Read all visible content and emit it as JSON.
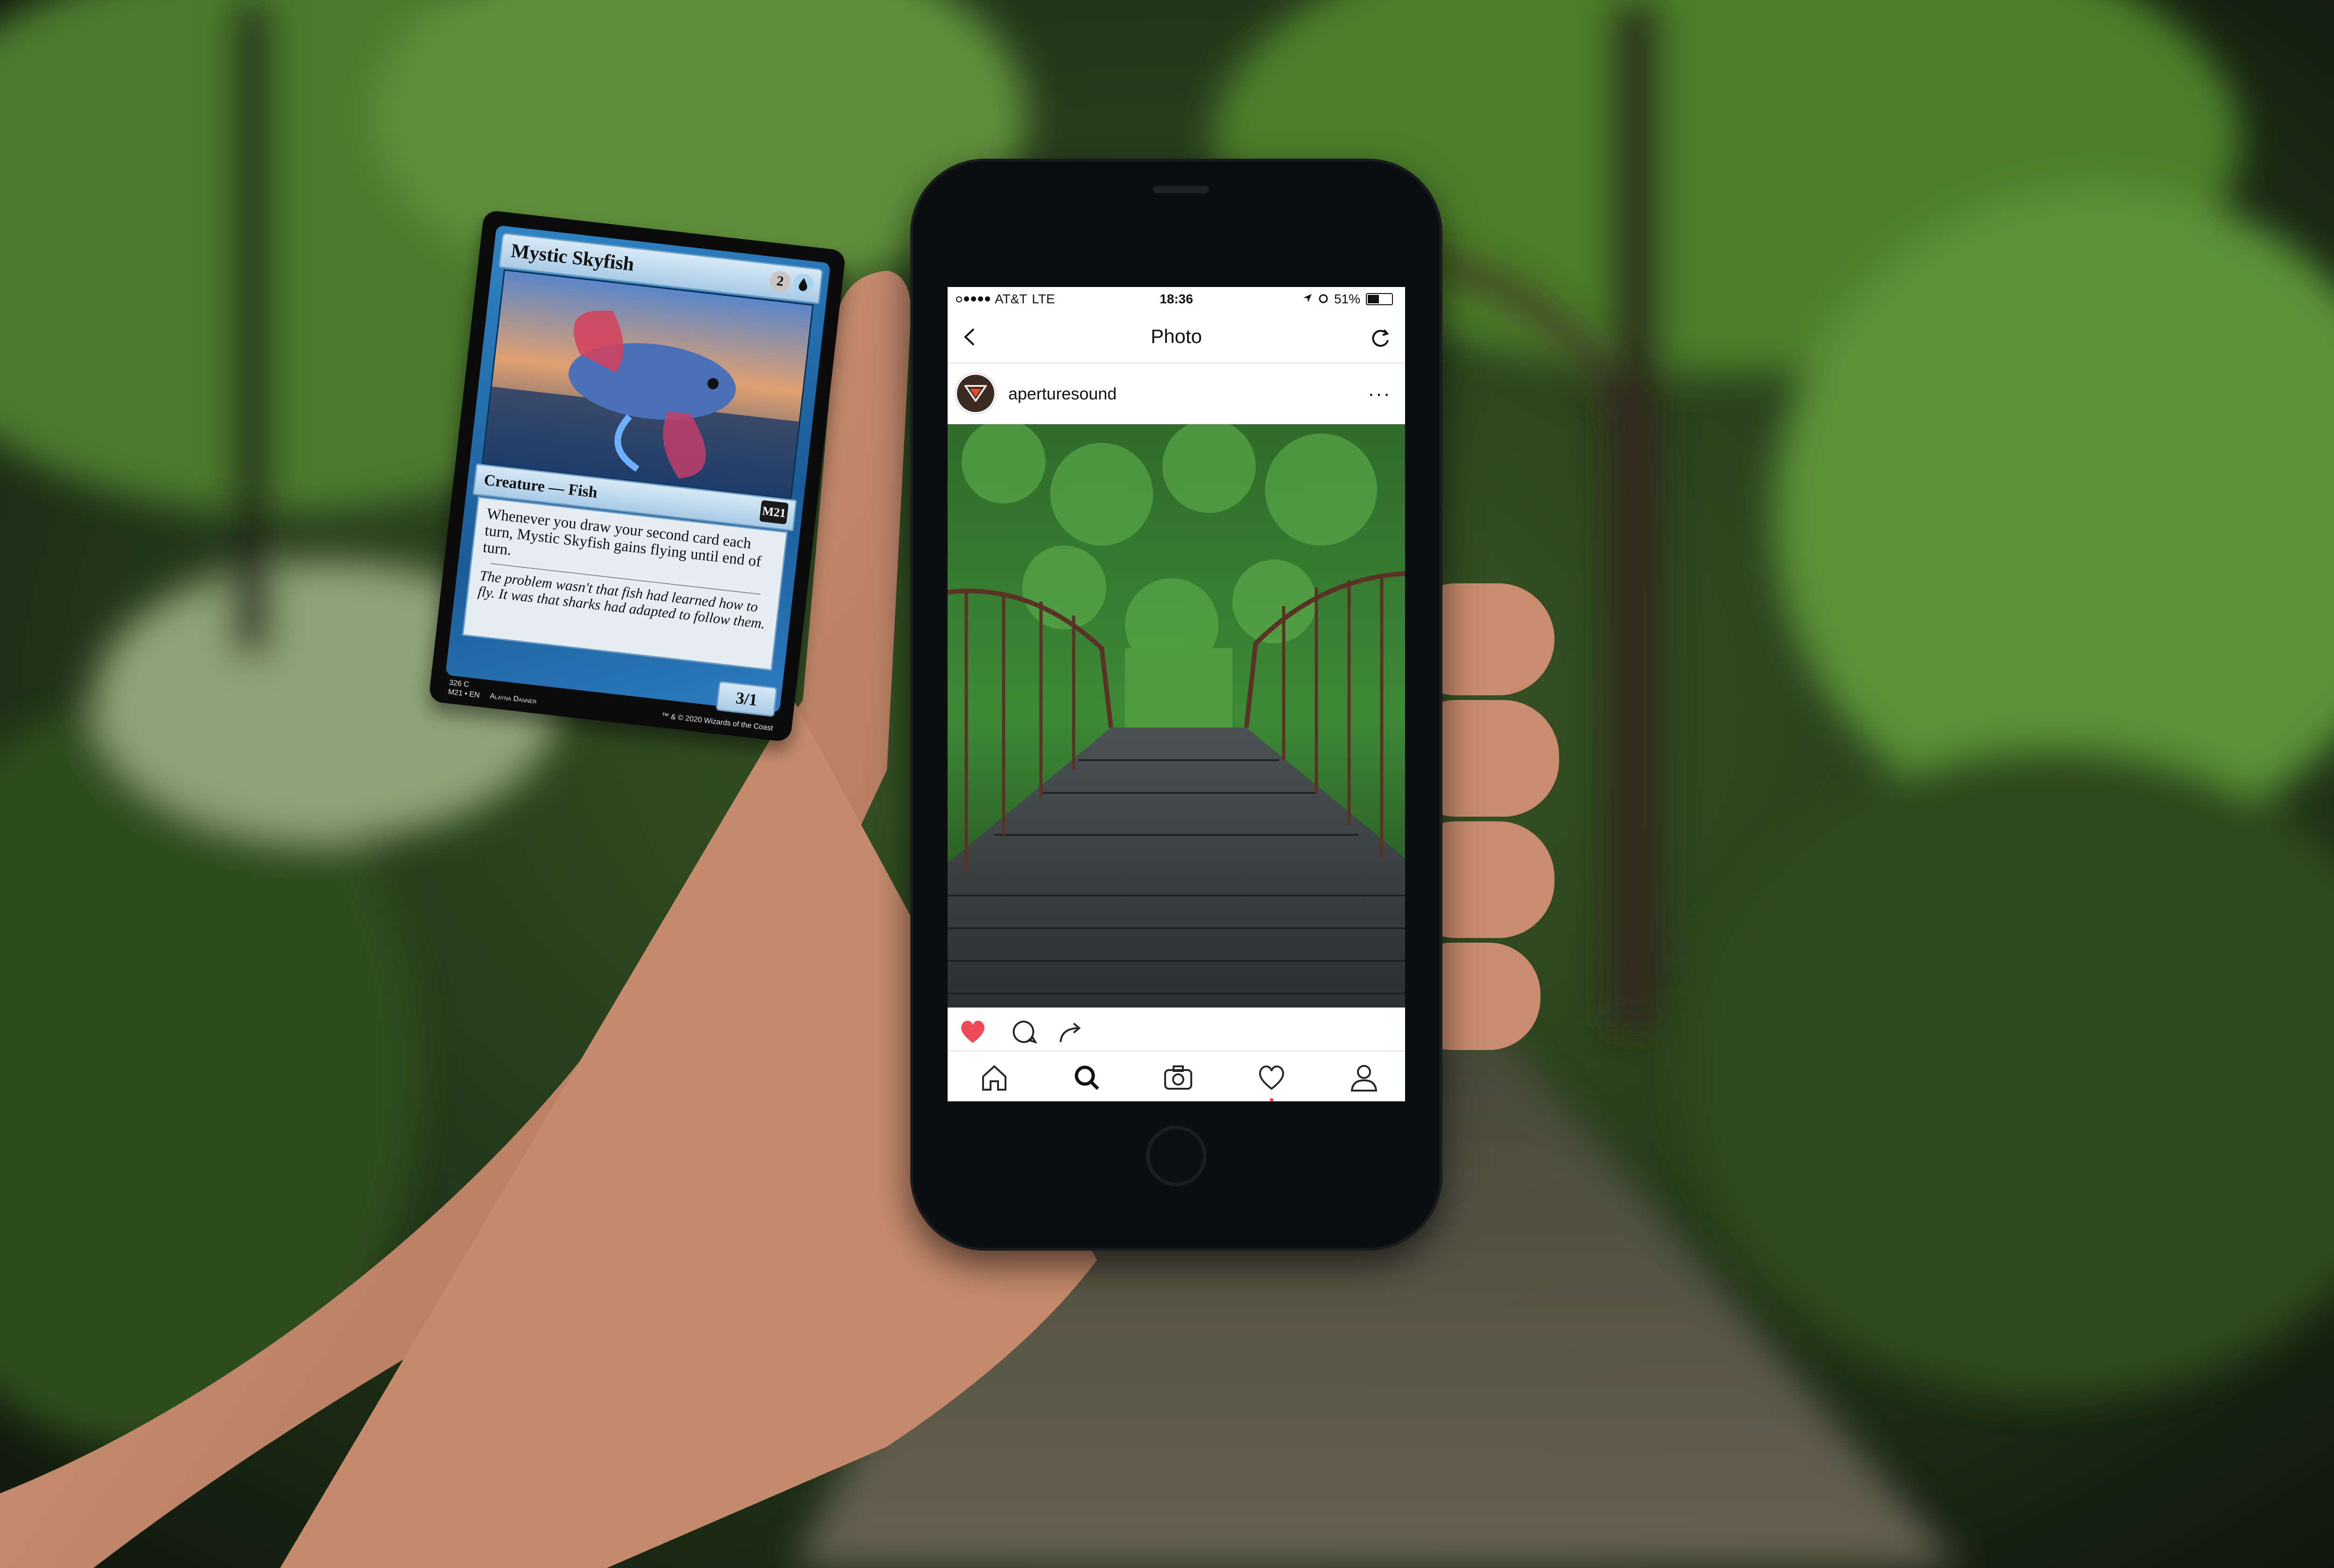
{
  "status_bar": {
    "carrier": "AT&T",
    "network": "LTE",
    "time": "18:36",
    "battery": "51%",
    "battery_level": 0.51
  },
  "nav": {
    "title": "Photo"
  },
  "post": {
    "username": "aperturesound",
    "more": "···",
    "liked": true
  },
  "icons": {
    "back": "chevron-left-icon",
    "refresh": "refresh-icon",
    "like": "heart-filled-icon",
    "comment": "comment-icon",
    "share": "share-icon",
    "home": "home-icon",
    "search": "search-icon",
    "camera": "camera-icon",
    "activity": "heart-outline-icon",
    "profile": "profile-icon"
  },
  "colors": {
    "like": "#ed4956",
    "card_frame": "#2f84c4"
  },
  "card": {
    "name": "Mystic Skyfish",
    "cost_generic": "2",
    "type_line": "Creature — Fish",
    "set_code": "M21",
    "rules_text": "Whenever you draw your second card each turn, Mystic Skyfish gains flying until end of turn.",
    "flavor_text": "The problem wasn't that fish had learned how to fly. It was that sharks had adapted to follow them.",
    "power_toughness": "3/1",
    "collector_line_1": "326   C",
    "collector_line_2": "M21 • EN",
    "artist": "Alayna Danner",
    "copyright": "™ & © 2020 Wizards of the Coast"
  }
}
